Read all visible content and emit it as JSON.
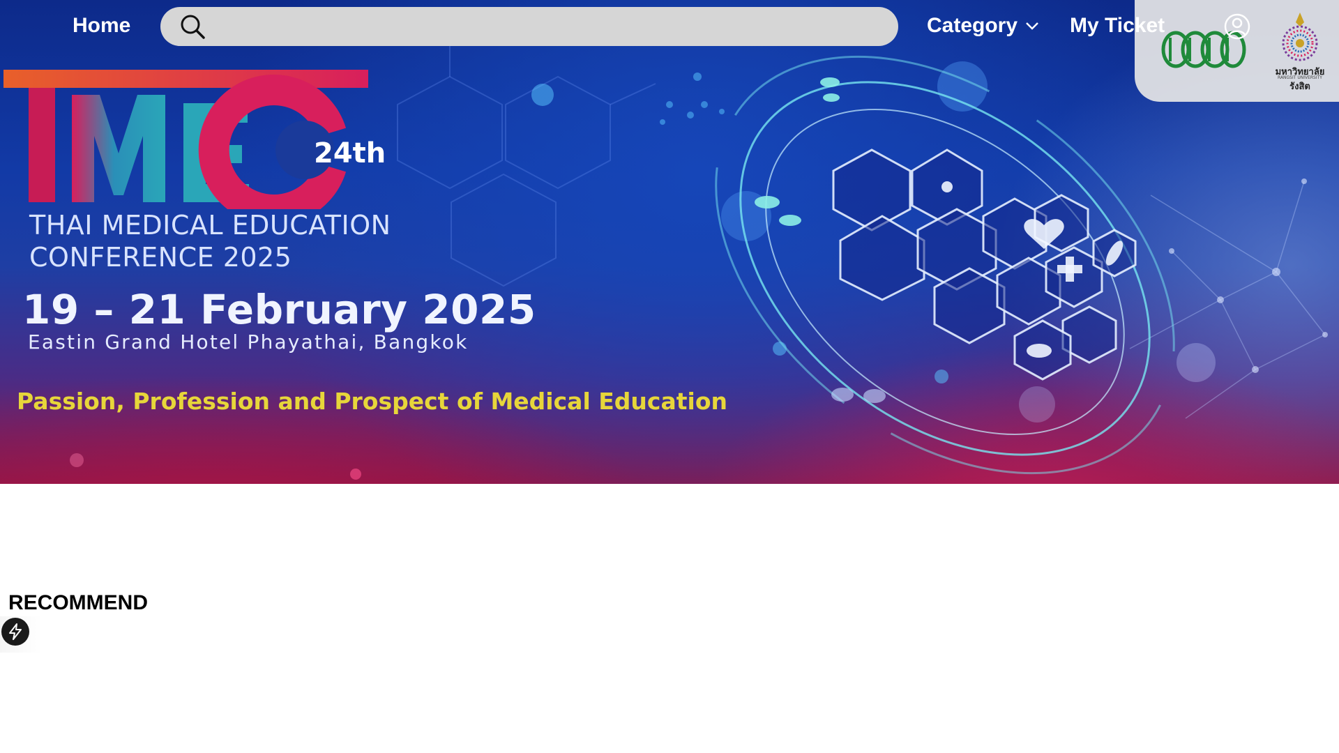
{
  "nav": {
    "home_label": "Home",
    "search_placeholder": "",
    "category_label": "Category",
    "ticket_label": "My Ticket"
  },
  "partners": {
    "rsu_name": "มหาวิทยาลัยรังสิต",
    "rsu_name_en": "RANGSIT UNIVERSITY"
  },
  "hero": {
    "logo_text": "TMEC",
    "edition": "24th",
    "title_line1": "THAI MEDICAL EDUCATION",
    "title_line2": "CONFERENCE 2025",
    "date": "19 – 21 February 2025",
    "venue": "Eastin Grand Hotel Phayathai, Bangkok",
    "tagline": "Passion, Profession and Prospect of Medical Education"
  },
  "main": {
    "section_title": "RECOMMEND"
  },
  "colors": {
    "search_bg": "#d6d6d6",
    "tagline": "#e7d63a",
    "tmec_pink": "#d81f5c",
    "tmec_teal": "#2aa6b8",
    "tmec_orange": "#e8602a",
    "partner_green": "#1f8a3a"
  },
  "icons": {
    "search": "search-icon",
    "category_chevron": "chevron-down-icon",
    "user": "user-circle-icon",
    "floating": "bolt-icon"
  }
}
